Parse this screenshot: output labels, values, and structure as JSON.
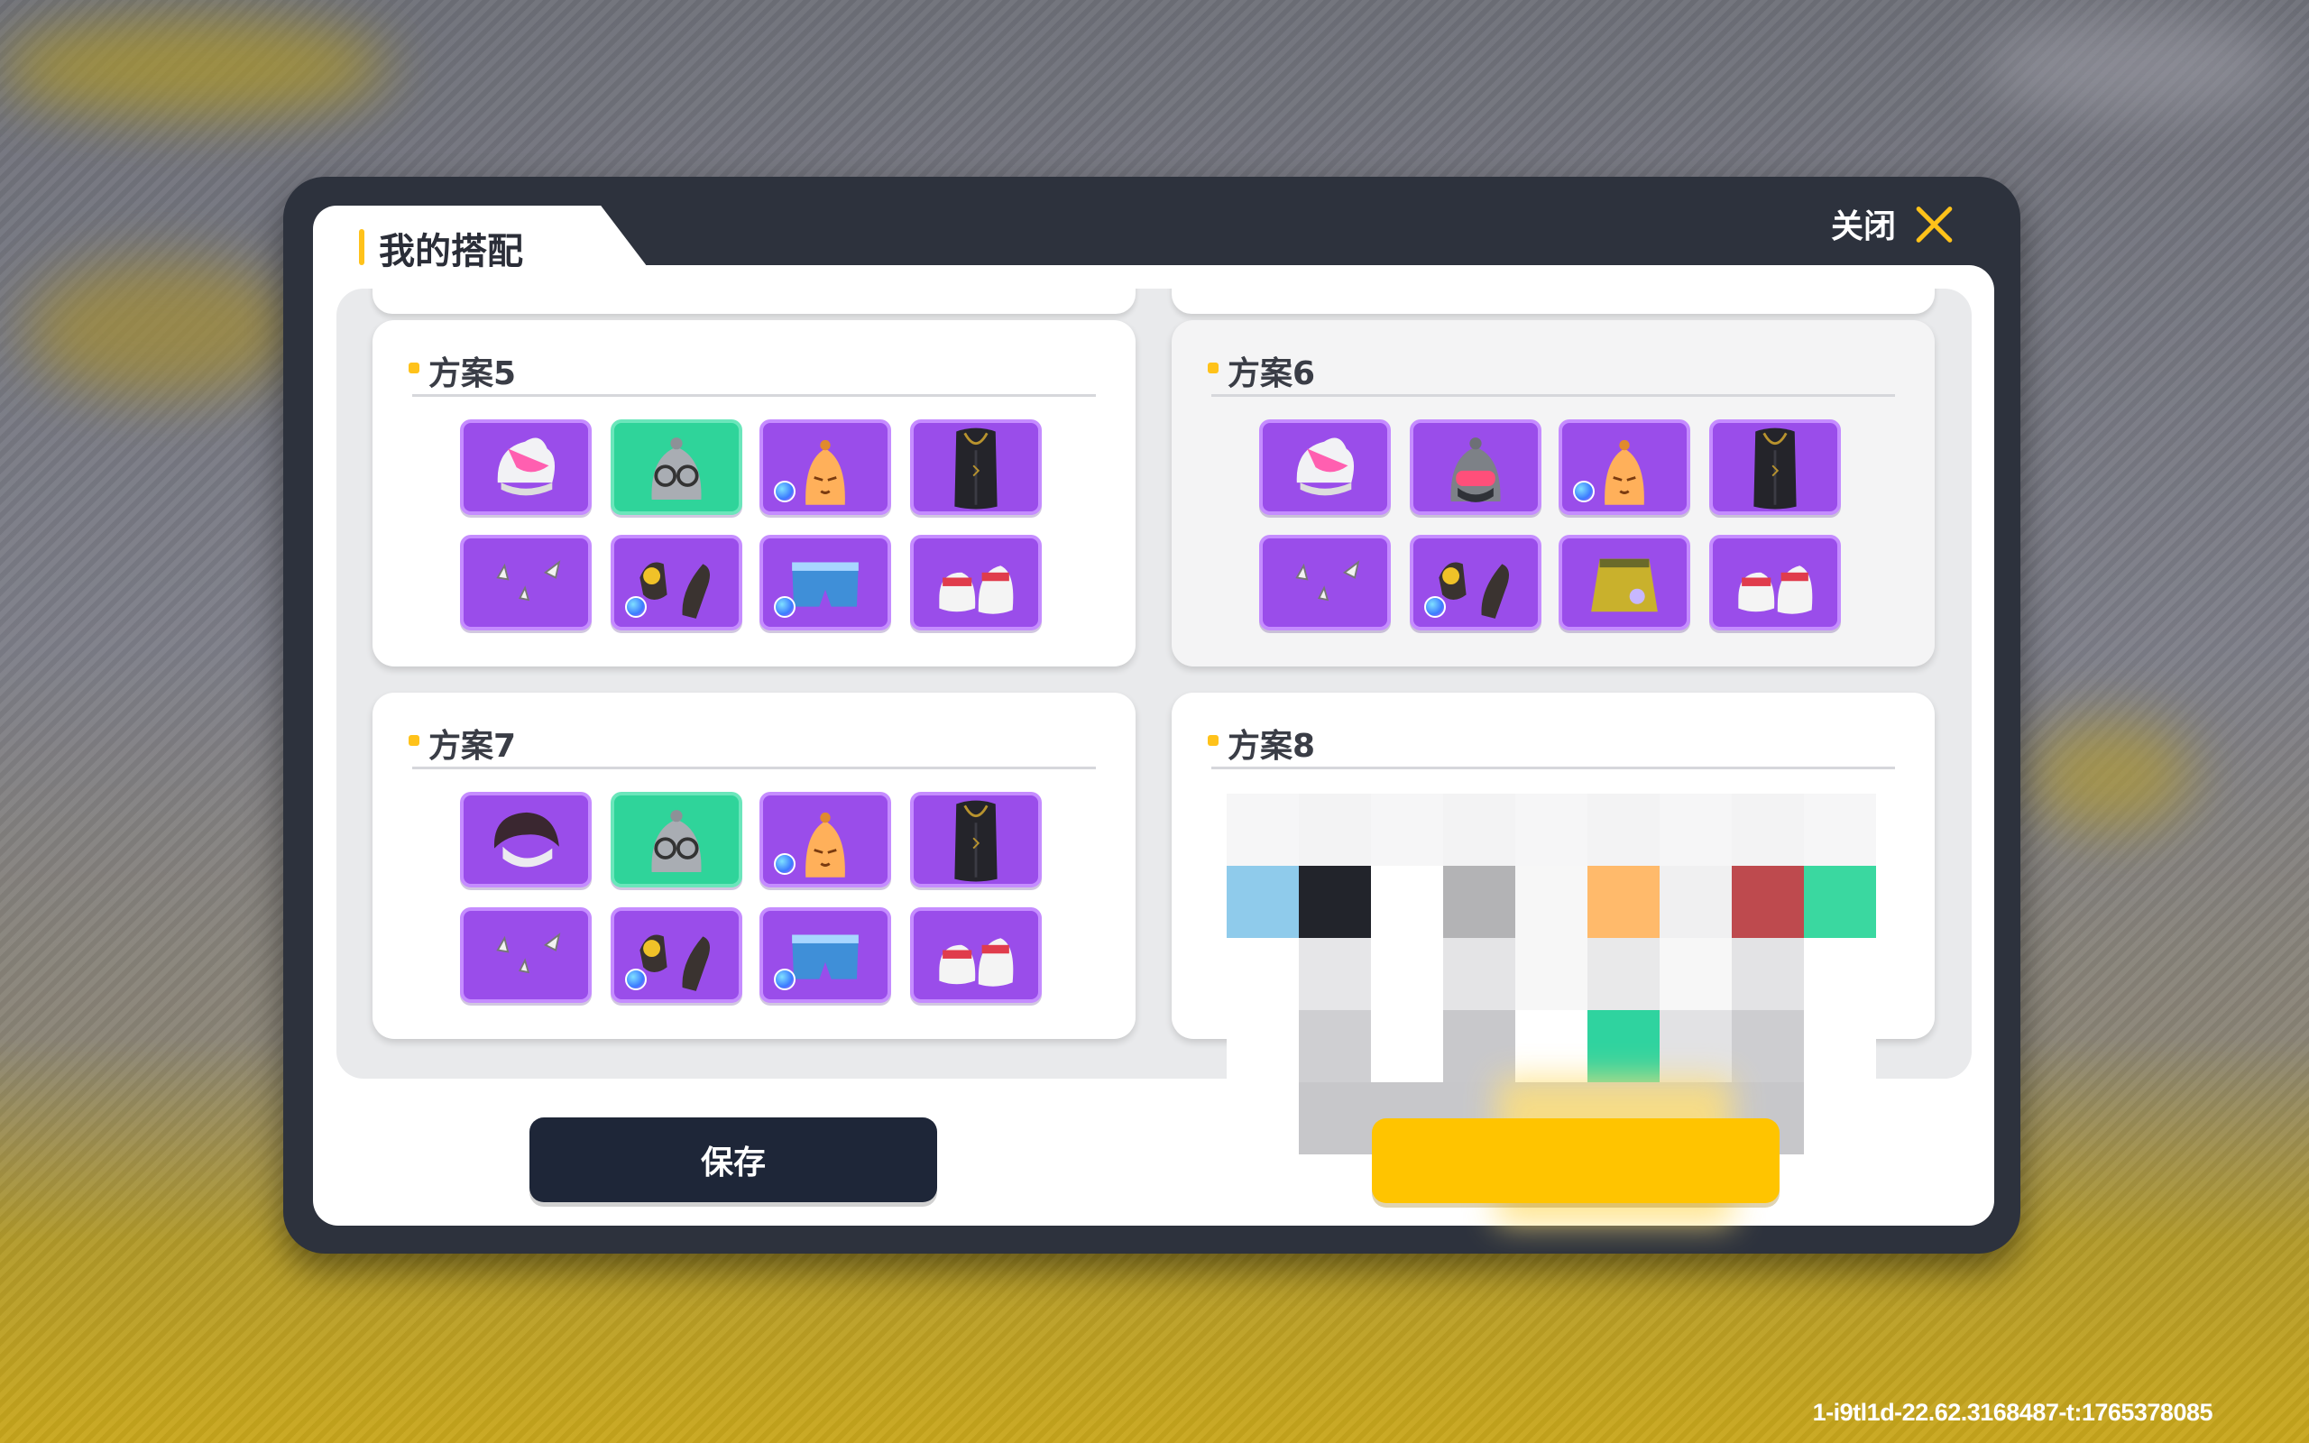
{
  "title": "我的搭配",
  "close_label": "关闭",
  "outfits": [
    {
      "name": "方案5",
      "slots": [
        {
          "item": "pink-hair-icon",
          "color": "purple",
          "badge": false
        },
        {
          "item": "grey-hood-glasses-icon",
          "color": "green",
          "badge": false
        },
        {
          "item": "orange-beanie-face-icon",
          "color": "purple",
          "badge": true
        },
        {
          "item": "black-robe-icon",
          "color": "purple",
          "badge": false
        },
        {
          "item": "white-wings-icon",
          "color": "purple",
          "badge": false
        },
        {
          "item": "black-gloves-icon",
          "color": "purple",
          "badge": true
        },
        {
          "item": "blue-shorts-icon",
          "color": "purple",
          "badge": true
        },
        {
          "item": "red-white-shoes-icon",
          "color": "purple",
          "badge": false
        }
      ]
    },
    {
      "name": "方案6",
      "slots": [
        {
          "item": "pink-hair-icon",
          "color": "purple",
          "badge": false
        },
        {
          "item": "grey-hood-mask-icon",
          "color": "purple",
          "badge": false
        },
        {
          "item": "orange-beanie-face-icon",
          "color": "purple",
          "badge": true
        },
        {
          "item": "black-robe-icon",
          "color": "purple",
          "badge": false
        },
        {
          "item": "white-wings-icon",
          "color": "purple",
          "badge": false
        },
        {
          "item": "black-gloves-icon",
          "color": "purple",
          "badge": true
        },
        {
          "item": "yellow-skirt-icon",
          "color": "purple",
          "badge": false
        },
        {
          "item": "red-white-shoes-icon",
          "color": "purple",
          "badge": false
        }
      ]
    },
    {
      "name": "方案7",
      "slots": [
        {
          "item": "dark-hair-icon",
          "color": "purple",
          "badge": false
        },
        {
          "item": "grey-hood-glasses-icon",
          "color": "green",
          "badge": false
        },
        {
          "item": "orange-beanie-face-icon",
          "color": "purple",
          "badge": true
        },
        {
          "item": "black-robe-icon",
          "color": "purple",
          "badge": false
        },
        {
          "item": "white-wings-icon",
          "color": "purple",
          "badge": false
        },
        {
          "item": "black-gloves-icon",
          "color": "purple",
          "badge": true
        },
        {
          "item": "blue-shorts-icon",
          "color": "purple",
          "badge": true
        },
        {
          "item": "red-white-shoes-icon",
          "color": "purple",
          "badge": false
        }
      ]
    },
    {
      "name": "方案8"
    }
  ],
  "save_label": "保存",
  "apply_label": "",
  "watermark": "1-i9tl1d-22.62.3168487-t:1765378085"
}
